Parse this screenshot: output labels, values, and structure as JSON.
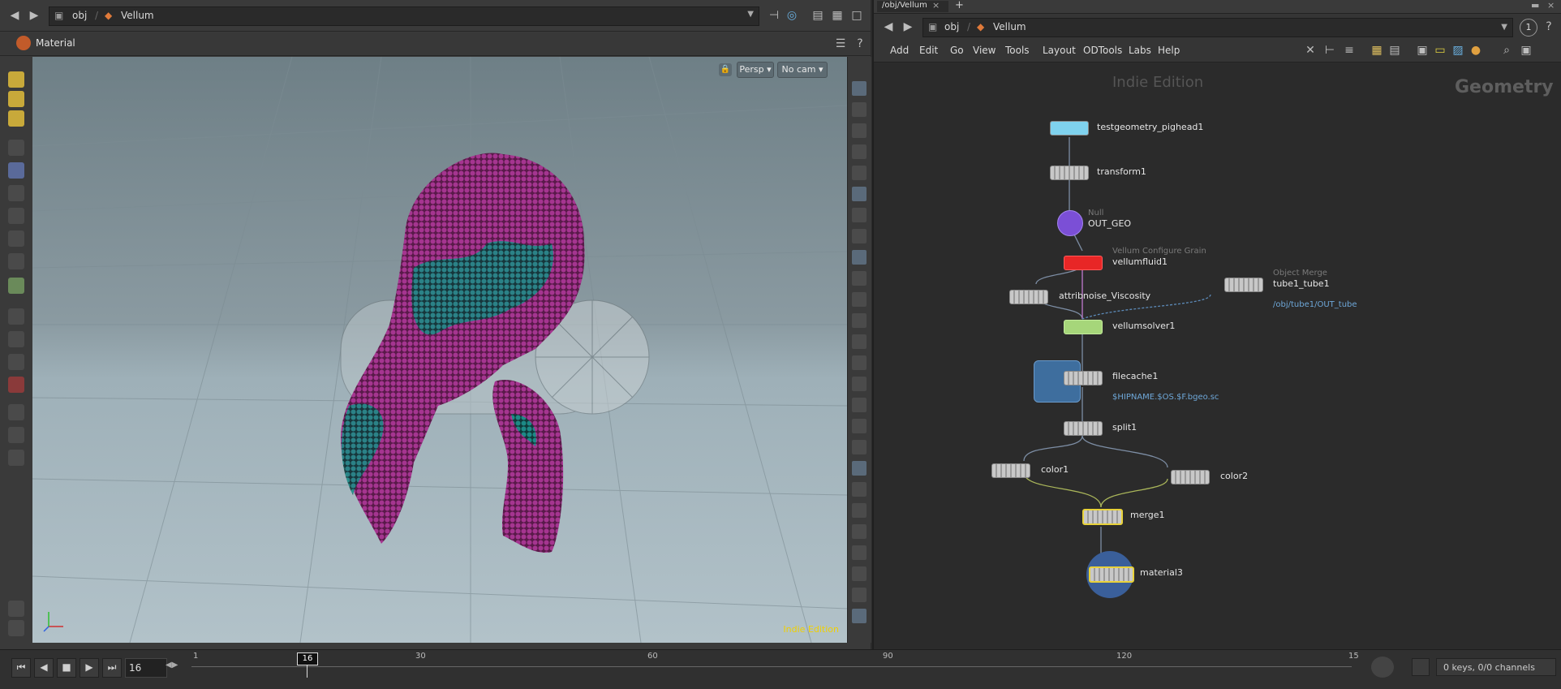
{
  "left_pane": {
    "path_root": "obj",
    "path_current": "Vellum",
    "section_title": "Material",
    "viewport": {
      "persp_label": "Persp",
      "cam_label": "No cam",
      "watermark": "Indie Edition"
    }
  },
  "right_pane": {
    "tab_path": "/obj/Vellum",
    "path_root": "obj",
    "path_current": "Vellum",
    "badge": "1",
    "menu": [
      "Add",
      "Edit",
      "Go",
      "View",
      "Tools",
      "Layout",
      "ODTools",
      "Labs",
      "Help"
    ],
    "watermark": "Indie Edition",
    "context_label": "Geometry",
    "nodes": {
      "testgeometry": "testgeometry_pighead1",
      "transform": "transform1",
      "null_type": "Null",
      "null_name": "OUT_GEO",
      "vfluid_type": "Vellum Configure Grain",
      "vfluid_name": "vellumfluid1",
      "attribnoise": "attribnoise_Viscosity",
      "objmerge_type": "Object Merge",
      "objmerge_name": "tube1_tube1",
      "objmerge_path": "/obj/tube1/OUT_tube",
      "solver": "vellumsolver1",
      "filecache": "filecache1",
      "filecache_path": "$HIPNAME.$OS.$F.bgeo.sc",
      "split": "split1",
      "color1": "color1",
      "color2": "color2",
      "merge": "merge1",
      "material": "material3"
    }
  },
  "timeline": {
    "current_frame": "16",
    "frame_marker": "16",
    "ticks": [
      "1",
      "30",
      "60",
      "90",
      "120",
      "15"
    ],
    "keys_label": "0 keys, 0/0 channels"
  }
}
